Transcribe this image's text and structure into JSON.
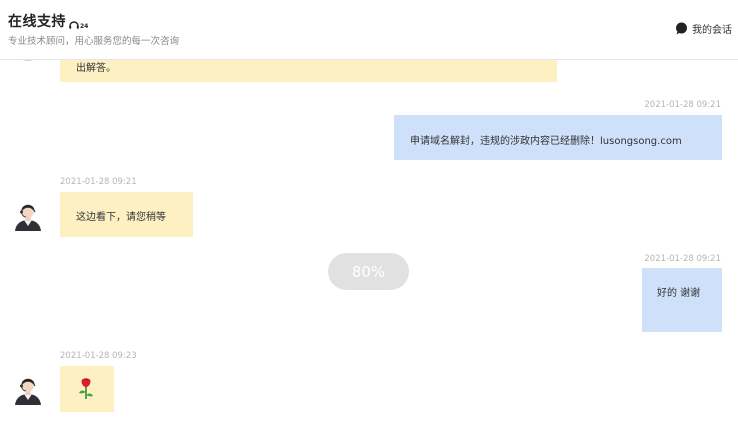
{
  "header": {
    "title": "在线支持",
    "title_badge": "24",
    "subtitle": "专业技术顾问，用心服务您的每一次咨询",
    "my_sessions_label": "我的会话"
  },
  "messages": [
    {
      "id": "prev",
      "side": "left",
      "text": "出解答。"
    },
    {
      "id": "m1",
      "side": "right",
      "time": "2021-01-28 09:21",
      "text": "申请域名解封，违规的涉政内容已经删除！lusongsong.com"
    },
    {
      "id": "m2",
      "side": "left",
      "time": "2021-01-28 09:21",
      "text": "这边看下，请您稍等"
    },
    {
      "id": "m3",
      "side": "right",
      "time": "2021-01-28 09:21",
      "text": "好的 谢谢"
    },
    {
      "id": "m4",
      "side": "left",
      "time": "2021-01-28 09:23",
      "content": "rose-emoji"
    }
  ],
  "zoom_level": "80%",
  "colors": {
    "agent_bubble": "#fdf1c4",
    "user_bubble": "#cfe0fb",
    "timestamp": "#b5b5b5"
  }
}
